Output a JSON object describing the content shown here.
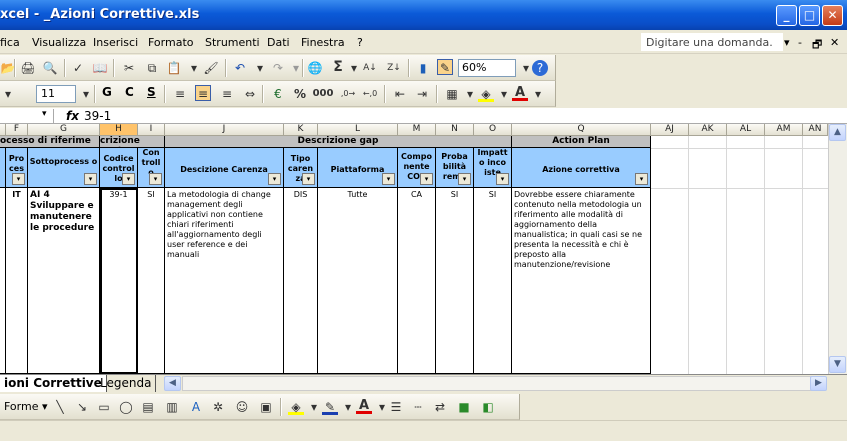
{
  "window": {
    "title": "xcel - _Azioni Correttive.xls",
    "min": "_",
    "max": "□",
    "close": "✕"
  },
  "menu": [
    "fica",
    "Visualizza",
    "Inserisci",
    "Formato",
    "Strumenti",
    "Dati",
    "Finestra",
    "?"
  ],
  "ask": {
    "placeholder": "Digitare una domanda."
  },
  "toolbar": {
    "zoom": "60%",
    "font_size": "11",
    "bold": "G",
    "italic": "C",
    "underline": "S",
    "sigma": "Σ",
    "font_color_letter": "A",
    "pct": "%",
    "thousands": "000"
  },
  "formula": {
    "fx": "fx",
    "value": "39-1"
  },
  "columns": [
    "F",
    "G",
    "H",
    "I",
    "J",
    "K",
    "L",
    "M",
    "N",
    "O",
    "Q",
    "AJ",
    "AK",
    "AL",
    "AM",
    "AN"
  ],
  "groups": {
    "processo": "ocesso di riferime",
    "descrizione_cont": "crizione cont",
    "descrizione_gap": "Descrizione gap",
    "action_plan": "Action Plan"
  },
  "headers": {
    "processo": "Pro ces",
    "sottoprocesso": "Sottoprocess o",
    "codice": "Codice control lo",
    "controllo": "Con troll o",
    "carenza": "Descizione Carenza",
    "tipo": "Tipo caren za",
    "piattaforma": "Piattaforma",
    "componente": "Compo nente COS",
    "probabilita": "Proba bilità reme",
    "impatto": "Impatt o inco iste",
    "azione": "Azione correttiva"
  },
  "row": {
    "processo": "IT",
    "sottoprocesso": "AI 4 Sviluppare e manutenere le procedure",
    "codice": "39-1",
    "controllo": "SI",
    "carenza": "La metodologia di change management degli applicativi non contiene chiari riferimenti all'aggiornamento degli user reference e dei manuali",
    "tipo": "DIS",
    "piattaforma": "Tutte",
    "componente": "CA",
    "probabilita": "SI",
    "impatto": "SI",
    "azione": "Dovrebbe essere chiaramente contenuto nella metodologia un riferimento alle modalità di aggiornamento della manualistica; in quali casi se ne presenta la necessità e chi è preposto alla manutenzione/revisione"
  },
  "sheets": {
    "active": "ioni Correttive",
    "other": "Legenda"
  },
  "drawing": {
    "forme": "Forme"
  },
  "colors": {
    "title": "#0a4ec8",
    "header_gray": "#c0c0c0",
    "header_blue": "#99ccff",
    "selected_col": "#ffc36a"
  }
}
